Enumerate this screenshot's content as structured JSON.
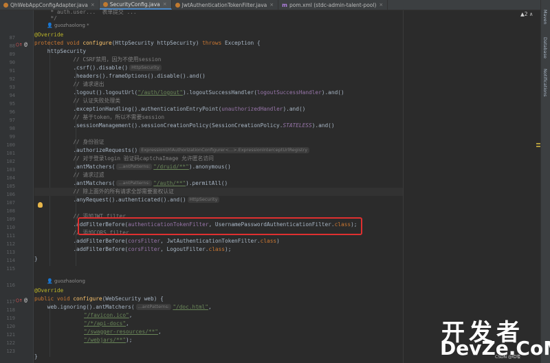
{
  "tabs": [
    {
      "label": "QhWebAppConfigAdapter.java",
      "close": "×",
      "icon_color": "#c07a30",
      "active": false
    },
    {
      "label": "SecurityConfig.java",
      "close": "×",
      "icon_color": "#c07a30",
      "active": true
    },
    {
      "label": "JwtAuthenticationTokenFilter.java",
      "close": "×",
      "icon_color": "#c07a30",
      "active": false
    },
    {
      "label": "pom.xml (stdc-admin-talent-pool)",
      "close": "×",
      "icon_color": "#7a5fb0",
      "active": false
    }
  ],
  "tab_prefix_m": "m",
  "warning_badge": "▲2 ∧",
  "side_labels": {
    "maven": "Maven",
    "database": "Database",
    "notifications": "Notifications"
  },
  "authors": {
    "a1": "guozhaolong *",
    "a2": "guozhaolong"
  },
  "gutter_numbers": [
    "87",
    "88",
    "89",
    "90",
    "91",
    "92",
    "93",
    "94",
    "95",
    "96",
    "97",
    "98",
    "99",
    "100",
    "101",
    "102",
    "103",
    "104",
    "105",
    "106",
    "107",
    "108",
    "109",
    "110",
    "111",
    "112",
    "113",
    "114",
    "115",
    "116",
    "117",
    "118",
    "119",
    "120",
    "121",
    "122",
    "123"
  ],
  "code": {
    "l_top1": "     * auth.user...  表单提交 ... ",
    "l_top2": "     */",
    "l_override1": "@Override",
    "l_sig1_a": "protected void ",
    "l_sig1_fn": "configure",
    "l_sig1_b": "(HttpSecurity httpSecurity) ",
    "l_sig1_kw": "throws",
    "l_sig1_c": " Exception {",
    "l_hs": "    httpSecurity",
    "c_csrf": "            // CSRF禁用，因为不使用session",
    "l_csrf": "            .csrf().disable()",
    "h_httpsecurity": "HttpSecurity",
    "l_headers": "            .headers().frameOptions().disable().and()",
    "c_logout": "            // 请求退出",
    "l_logout_a": "            .logout().logoutUrl(",
    "l_logout_s": "\"/auth/logout\"",
    "l_logout_b": ").logoutSuccessHandler(",
    "l_logout_p": "logoutSuccessHandler",
    "l_logout_c": ").and()",
    "c_auth_fail": "            // 认证失败处理类",
    "l_exc_a": "            .exceptionHandling().authenticationEntryPoint(",
    "l_exc_p": "unauthorizedHandler",
    "l_exc_b": ").and()",
    "c_token": "            // 基于token，所以不需要session",
    "l_sess_a": "            .sessionManagement().sessionCreationPolicy(SessionCreationPolicy.",
    "l_sess_i": "STATELESS",
    "l_sess_b": ").and()",
    "c_verify": "            // 身份验证",
    "l_authreq": "            .authorizeRequests()",
    "h_expr": "ExpressionUrlAuthorizationConfigurer<...>.ExpressionInterceptUrlRegistry",
    "c_login": "            // 对于登录login 验证码captchaImage 允许匿名访问",
    "l_am1_a": "            .antMatchers(",
    "h_antpatterns": "...antPatterns:",
    "l_am1_s": "\"/druid/**\"",
    "l_am1_b": ").anonymous()",
    "c_filter": "            // 请求过滤",
    "l_am2_a": "            .antMatchers(",
    "l_am2_s": "\"/auth/**\"",
    "l_am2_b": ").permitAll()",
    "c_others": "            // 除上面外的所有请求全部需要鉴权认证",
    "l_any": "            .anyRequest().authenticated().and()",
    "c_jwt": "            // 添加JWT filter",
    "l_jwt_a": "            .addFilterBefore(",
    "l_jwt_p": "authenticationTokenFilter",
    "l_jwt_b": ", UsernamePasswordAuthenticationFilter.",
    "l_jwt_k": "class",
    "l_jwt_c": ");",
    "c_cors": "            // 添加CORS filter",
    "l_cors1_a": "            .addFilterBefore(",
    "l_cors1_p": "corsFilter",
    "l_cors1_b": ", JwtAuthenticationTokenFilter.",
    "l_cors1_k": "class",
    "l_cors1_c": ")",
    "l_cors2_a": "            .addFilterBefore(",
    "l_cors2_p": "corsFilter",
    "l_cors2_b": ", LogoutFilter.",
    "l_cors2_k": "class",
    "l_cors2_c": ");",
    "l_close1": "}",
    "l_override2": "@Override",
    "l_sig2_a": "public void ",
    "l_sig2_fn": "configure",
    "l_sig2_b": "(WebSecurity web) {",
    "l_web_a": "    web.ignoring().antMatchers(",
    "l_web_s": "\"/doc.html\"",
    "l_web_b": ",",
    "l_fav": "\"/favicon.ico\"",
    "l_api": "\"/*/api-docs\"",
    "l_swag": "\"/swagger-resources/**\"",
    "l_webj": "\"/webjars/**\"",
    "l_comma": ",",
    "l_webj_end": ");",
    "l_close2": "}"
  },
  "watermark": {
    "line1": "开发者",
    "line2": "DevZe.CoM",
    "line3": "CSDN @哈喽"
  }
}
